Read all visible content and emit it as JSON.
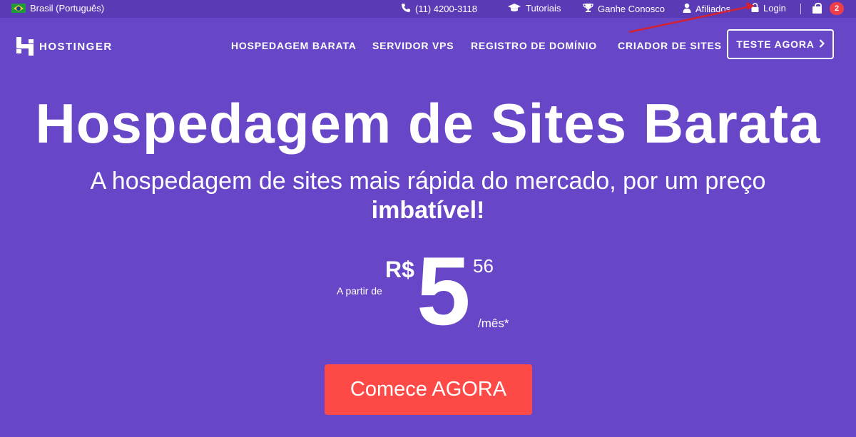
{
  "topbar": {
    "language": "Brasil (Português)",
    "phone": "(11) 4200-3118",
    "tutorials": "Tutoriais",
    "earn": "Ganhe Conosco",
    "affiliates": "Afiliados",
    "login": "Login",
    "cart_count": "2"
  },
  "header": {
    "logo_text": "HOSTINGER",
    "nav": [
      "HOSPEDAGEM BARATA",
      "SERVIDOR VPS",
      "REGISTRO DE DOMÍNIO",
      "CRIADOR DE SITES"
    ],
    "cta_label": "TESTE AGORA"
  },
  "hero": {
    "title": "Hospedagem de Sites Barata",
    "subtitle": "A hospedagem de sites mais rápida do mercado, por um preço",
    "subtitle_bold": "imbatível!",
    "price": {
      "from": "A partir de",
      "currency": "R$",
      "integer": "5",
      "cents": "56",
      "period": "/mês*"
    },
    "cta_label": "Comece AGORA"
  },
  "colors": {
    "background": "#6747c7",
    "topbar": "#5a3bb5",
    "cta": "#fd4a47",
    "badge": "#ef3e4a",
    "annotation_arrow": "#d4202f"
  }
}
